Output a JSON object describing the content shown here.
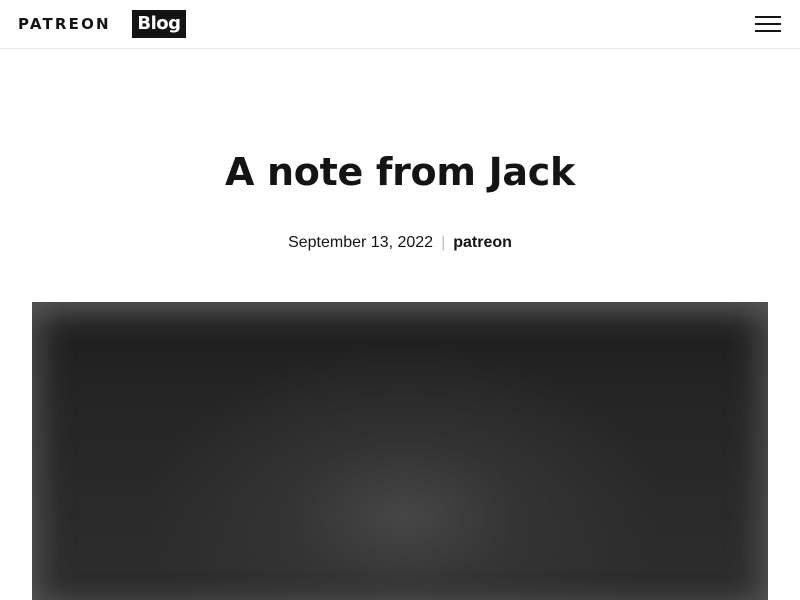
{
  "header": {
    "logo_text": "PATREON",
    "logo_badge": "Blog",
    "menu_icon": "hamburger-menu-icon"
  },
  "post": {
    "title": "A note from Jack",
    "date": "September 13, 2022",
    "separator": "|",
    "author": "patreon"
  },
  "hero_image": {
    "description_visible": ""
  },
  "colors": {
    "text": "#141414",
    "background": "#ffffff",
    "separator": "#bdbdbd",
    "hero_dark": "#2a2a2a"
  }
}
